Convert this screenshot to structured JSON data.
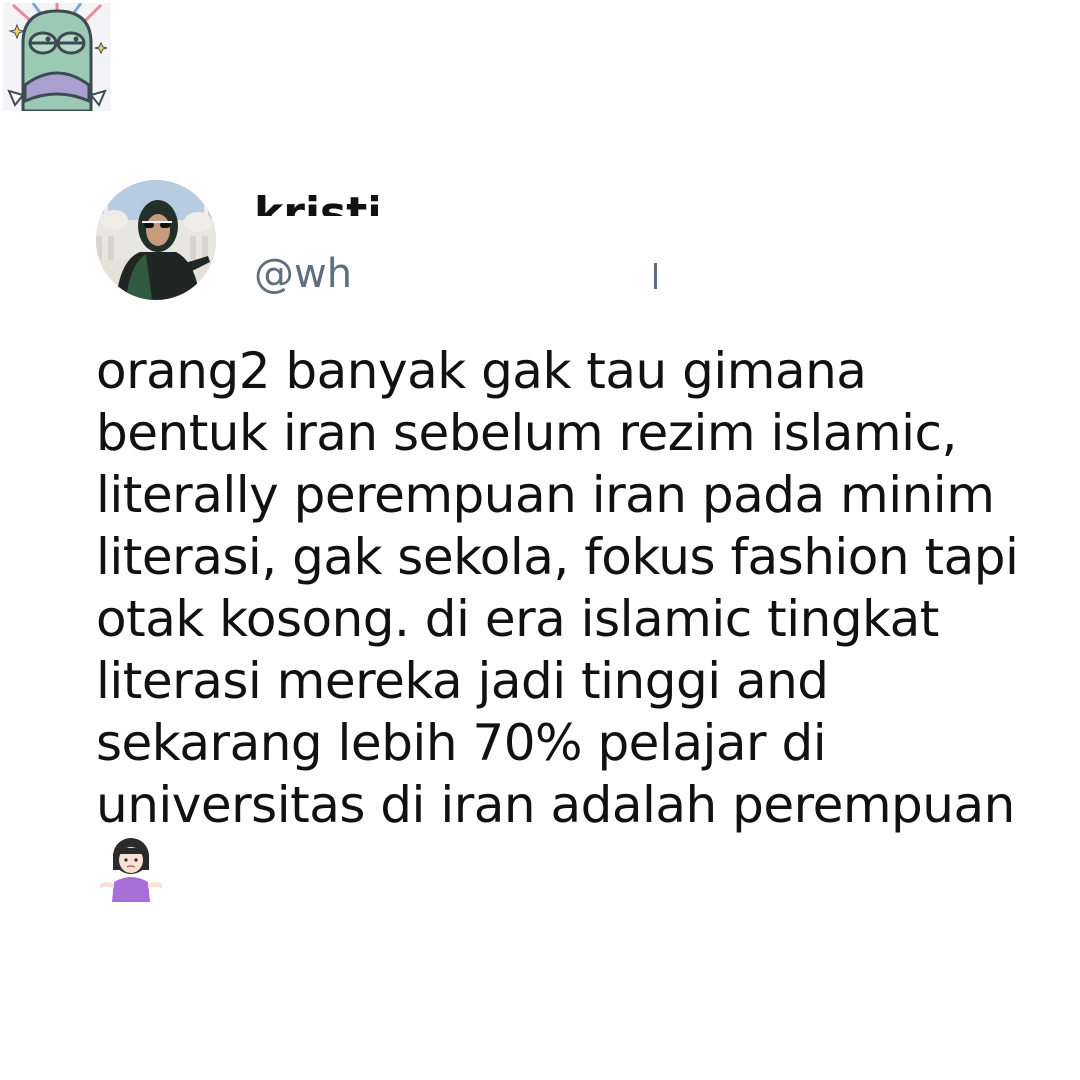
{
  "sticker": {
    "icon": "cartoon-fish-sticker-icon"
  },
  "tweet": {
    "avatar_icon": "profile-photo-avatar",
    "display_name": "kristin",
    "handle": "@wh",
    "text": " orang2 banyak gak tau gimana\nbentuk iran sebelum rezim islamic,\nliterally perempuan iran pada minim\nliterasi, gak sekola, fokus fashion tapi\notak kosong. di era islamic tingkat\nliterasi mereka jadi tinggi and\nsekarang lebih 70% pelajar di\nuniversitas di iran adalah perempuan",
    "emoji": "woman-shrugging-emoji-icon"
  },
  "colors": {
    "background": "#ffffff",
    "text": "#111111",
    "handle": "#5f6f7f"
  }
}
